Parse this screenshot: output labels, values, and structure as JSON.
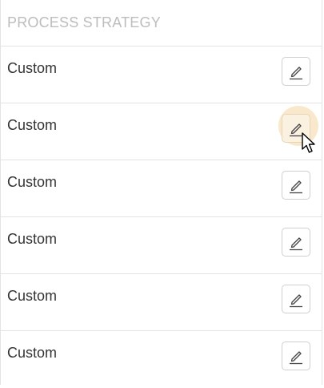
{
  "table": {
    "column_header": "PROCESS STRATEGY",
    "rows": [
      {
        "label": "Custom",
        "action_icon": "pencil-edit-icon"
      },
      {
        "label": "Custom",
        "action_icon": "pencil-edit-icon",
        "state": "hover"
      },
      {
        "label": "Custom",
        "action_icon": "pencil-edit-icon"
      },
      {
        "label": "Custom",
        "action_icon": "pencil-edit-icon"
      },
      {
        "label": "Custom",
        "action_icon": "pencil-edit-icon"
      },
      {
        "label": "Custom",
        "action_icon": "pencil-edit-icon"
      }
    ]
  },
  "colors": {
    "header_text": "#bdbdbd",
    "row_text": "#333333",
    "divider": "#e3e3e3",
    "hover_highlight": "#f4d6a0"
  }
}
